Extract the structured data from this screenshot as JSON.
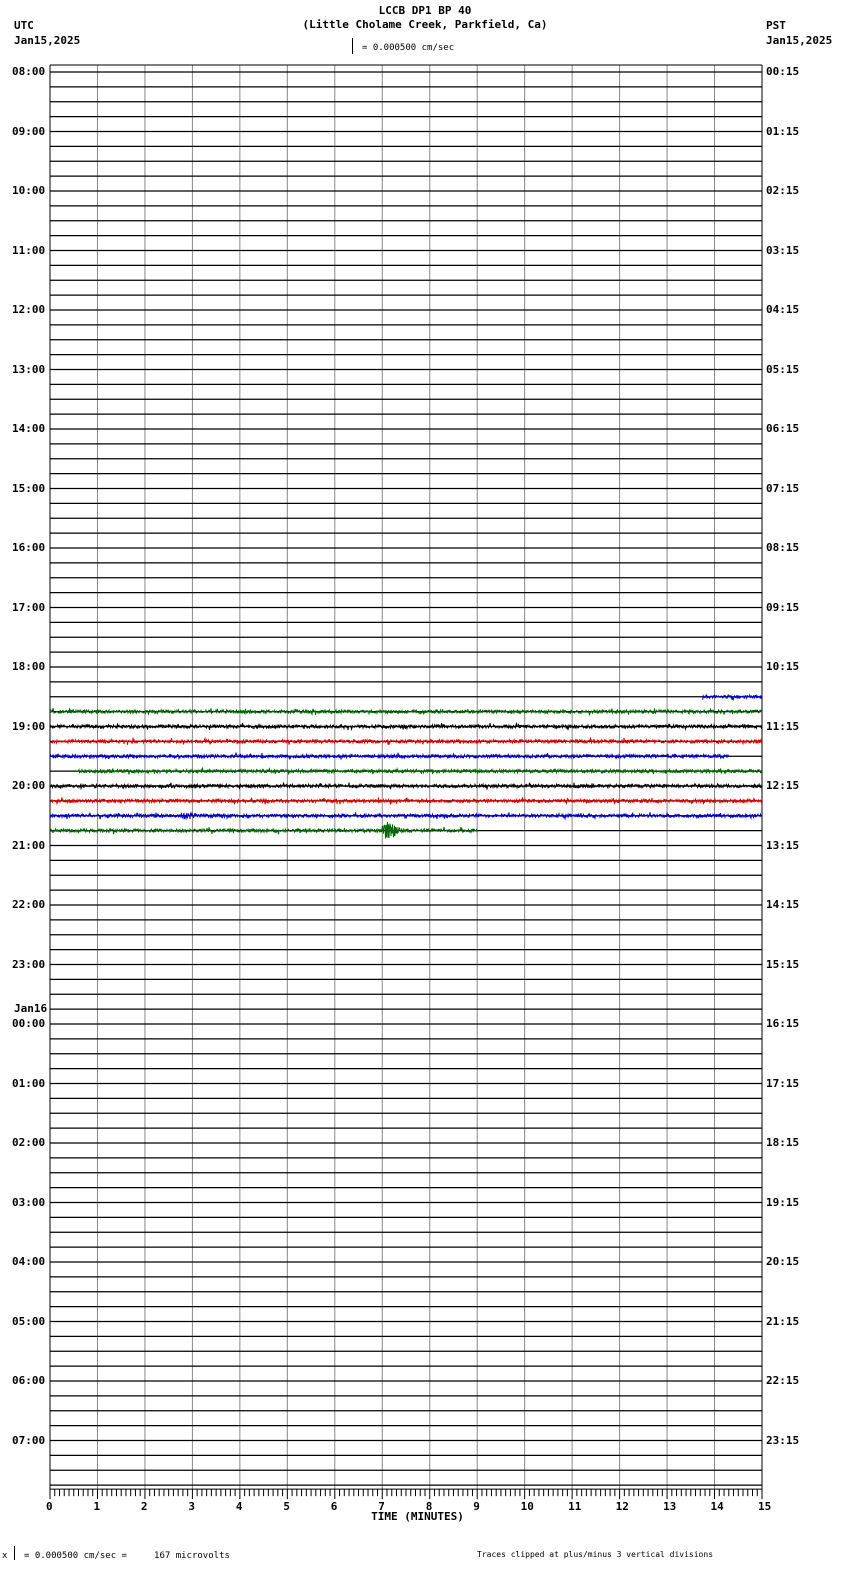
{
  "header": {
    "title": "LCCB DP1 BP 40",
    "subtitle": "(Little Cholame Creek, Parkfield, Ca)",
    "left_tz": "UTC",
    "left_date": "Jan15,2025",
    "right_tz": "PST",
    "right_date": "Jan15,2025",
    "scale_text": "= 0.000500 cm/sec"
  },
  "footer": {
    "scale_text": "= 0.000500 cm/sec =     167 microvolts",
    "clip_note": "Traces clipped at plus/minus 3 vertical divisions"
  },
  "chart_data": {
    "type": "line",
    "title": "LCCB DP1 BP 40",
    "xlabel": "TIME (MINUTES)",
    "xlim": [
      0,
      15
    ],
    "x_ticks": [
      "0",
      "1",
      "2",
      "3",
      "4",
      "5",
      "6",
      "7",
      "8",
      "9",
      "10",
      "11",
      "12",
      "13",
      "14",
      "15"
    ],
    "rows_per_hour": 4,
    "row_count": 96,
    "left_labels": [
      "08:00",
      "09:00",
      "10:00",
      "11:00",
      "12:00",
      "13:00",
      "14:00",
      "15:00",
      "16:00",
      "17:00",
      "18:00",
      "19:00",
      "20:00",
      "21:00",
      "22:00",
      "23:00",
      "00:00",
      "01:00",
      "02:00",
      "03:00",
      "04:00",
      "05:00",
      "06:00",
      "07:00"
    ],
    "right_labels": [
      "00:15",
      "01:15",
      "02:15",
      "03:15",
      "04:15",
      "05:15",
      "06:15",
      "07:15",
      "08:15",
      "09:15",
      "10:15",
      "11:15",
      "12:15",
      "13:15",
      "14:15",
      "15:15",
      "16:15",
      "17:15",
      "18:15",
      "19:15",
      "20:15",
      "21:15",
      "22:15",
      "23:15"
    ],
    "date_change_label": "Jan16",
    "date_change_hour_index": 16,
    "trace_colors": [
      "#000000",
      "#dd0000",
      "#0000cc",
      "#006600"
    ],
    "traces": [
      {
        "row": 42,
        "start_min": 13.75,
        "end_min": 15,
        "color": "#0000cc"
      },
      {
        "row": 43,
        "start_min": 0,
        "end_min": 15,
        "color": "#006600"
      },
      {
        "row": 44,
        "start_min": 0,
        "end_min": 15,
        "color": "#000000"
      },
      {
        "row": 45,
        "start_min": 0,
        "end_min": 15,
        "color": "#dd0000"
      },
      {
        "row": 46,
        "start_min": 0,
        "end_min": 14.3,
        "color": "#0000cc"
      },
      {
        "row": 47,
        "start_min": 0.6,
        "end_min": 15,
        "color": "#006600"
      },
      {
        "row": 48,
        "start_min": 0,
        "end_min": 15,
        "color": "#000000"
      },
      {
        "row": 49,
        "start_min": 0,
        "end_min": 15,
        "color": "#dd0000"
      },
      {
        "row": 50,
        "start_min": 0,
        "end_min": 15,
        "color": "#0000cc",
        "burst_min": 2.9
      },
      {
        "row": 51,
        "start_min": 0,
        "end_min": 9,
        "color": "#006600",
        "event_min": 7.1
      }
    ]
  }
}
